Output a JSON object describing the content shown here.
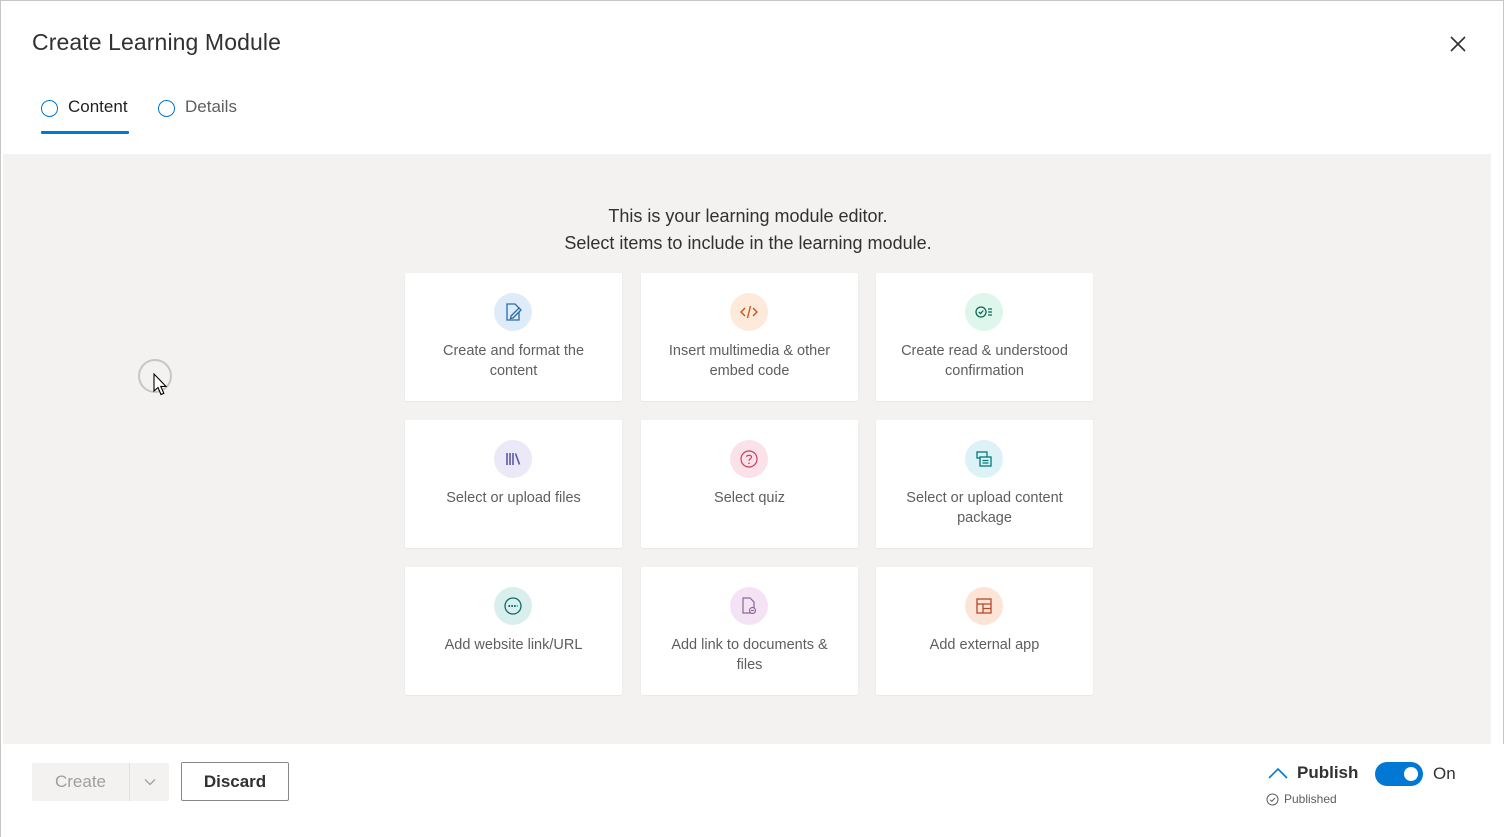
{
  "dialog": {
    "title": "Create Learning Module",
    "close_icon": "close-icon"
  },
  "tabs": [
    {
      "label": "Content",
      "active": true
    },
    {
      "label": "Details",
      "active": false
    }
  ],
  "editor": {
    "intro_line1": "This is your learning module editor.",
    "intro_line2": "Select items to include in the learning module."
  },
  "cards": [
    {
      "label": "Create and format the content",
      "icon": "edit-document-icon",
      "color": "#deecf9",
      "accent": "#2b6ca3"
    },
    {
      "label": "Insert multimedia & other embed code",
      "icon": "embed-code-icon",
      "color": "#fdeadb",
      "accent": "#ca5010"
    },
    {
      "label": "Create read & understood confirmation",
      "icon": "checklist-icon",
      "color": "#dff6ec",
      "accent": "#0b6a53"
    },
    {
      "label": "Select or upload files",
      "icon": "library-icon",
      "color": "#ebe8f7",
      "accent": "#5c5aa8"
    },
    {
      "label": "Select quiz",
      "icon": "question-icon",
      "color": "#fbe2e8",
      "accent": "#c43e62"
    },
    {
      "label": "Select or upload content package",
      "icon": "package-icon",
      "color": "#dcf2f7",
      "accent": "#03787c"
    },
    {
      "label": "Add website link/URL",
      "icon": "web-link-icon",
      "color": "#d9efee",
      "accent": "#0e6b6b"
    },
    {
      "label": "Add link to documents & files",
      "icon": "document-link-icon",
      "color": "#f4e3f4",
      "accent": "#8a6a94"
    },
    {
      "label": "Add external app",
      "icon": "app-grid-icon",
      "color": "#fce4d6",
      "accent": "#b7472a"
    }
  ],
  "footer": {
    "create_label": "Create",
    "discard_label": "Discard",
    "publish_label": "Publish",
    "published_status": "Published",
    "toggle_state": "On"
  },
  "colors": {
    "accent": "#0078d4",
    "editor_bg": "#f3f2f1"
  }
}
